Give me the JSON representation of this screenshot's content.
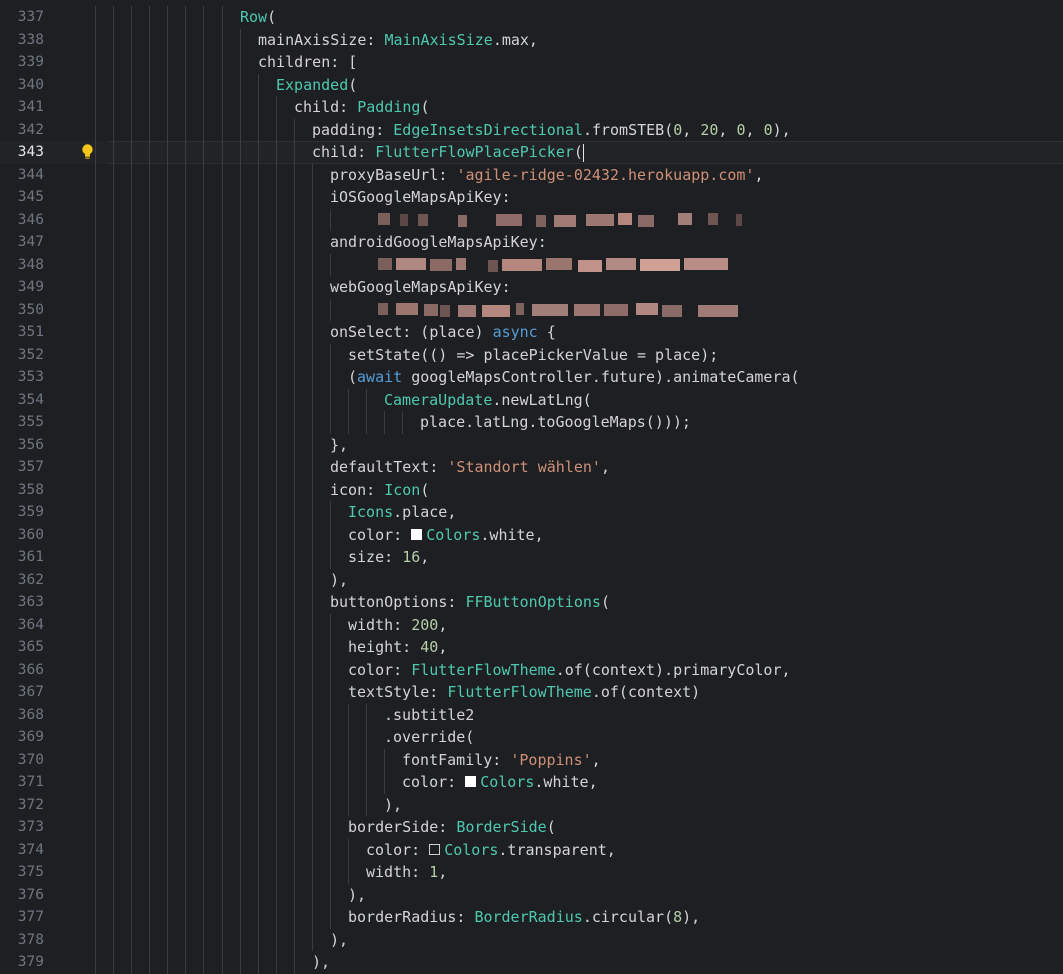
{
  "editor": {
    "colors": {
      "background": "#1e1f22",
      "text": "#d4d4d4",
      "type": "#4ec9b0",
      "string": "#ce9178",
      "number": "#b5cea8",
      "keyword": "#569cd6",
      "lineNumber": "#6e7681",
      "guide": "#3a3c40",
      "bulb": "#f5c518"
    },
    "activeLine": 343,
    "lines": [
      {
        "n": "337",
        "indent": 8,
        "tokens": [
          {
            "t": "Row",
            "c": "type"
          },
          {
            "t": "("
          }
        ]
      },
      {
        "n": "338",
        "indent": 9,
        "tokens": [
          {
            "t": "mainAxisSize: "
          },
          {
            "t": "MainAxisSize",
            "c": "type"
          },
          {
            "t": ".max,"
          }
        ]
      },
      {
        "n": "339",
        "indent": 9,
        "tokens": [
          {
            "t": "children: ["
          }
        ]
      },
      {
        "n": "340",
        "indent": 10,
        "tokens": [
          {
            "t": "Expanded",
            "c": "type"
          },
          {
            "t": "("
          }
        ]
      },
      {
        "n": "341",
        "indent": 11,
        "tokens": [
          {
            "t": "child: "
          },
          {
            "t": "Padding",
            "c": "type"
          },
          {
            "t": "("
          }
        ]
      },
      {
        "n": "342",
        "indent": 12,
        "tokens": [
          {
            "t": "padding: "
          },
          {
            "t": "EdgeInsetsDirectional",
            "c": "type"
          },
          {
            "t": ".fromSTEB("
          },
          {
            "t": "0",
            "c": "number"
          },
          {
            "t": ", "
          },
          {
            "t": "20",
            "c": "number"
          },
          {
            "t": ", "
          },
          {
            "t": "0",
            "c": "number"
          },
          {
            "t": ", "
          },
          {
            "t": "0",
            "c": "number"
          },
          {
            "t": "),"
          }
        ]
      },
      {
        "n": "343",
        "indent": 12,
        "bulb": true,
        "cursor": true,
        "tokens": [
          {
            "t": "child: "
          },
          {
            "t": "FlutterFlowPlacePicker",
            "c": "type"
          },
          {
            "t": "("
          }
        ]
      },
      {
        "n": "344",
        "indent": 13,
        "tokens": [
          {
            "t": "proxyBaseUrl: "
          },
          {
            "t": "'agile-ridge-02432.herokuapp.com'",
            "c": "string"
          },
          {
            "t": ","
          }
        ]
      },
      {
        "n": "345",
        "indent": 13,
        "tokens": [
          {
            "t": "iOSGoogleMapsApiKey:"
          }
        ]
      },
      {
        "n": "346",
        "indent": 14,
        "redact": "a",
        "tokens": []
      },
      {
        "n": "347",
        "indent": 13,
        "tokens": [
          {
            "t": "androidGoogleMapsApiKey:"
          }
        ]
      },
      {
        "n": "348",
        "indent": 14,
        "redact": "b",
        "tokens": []
      },
      {
        "n": "349",
        "indent": 13,
        "tokens": [
          {
            "t": "webGoogleMapsApiKey:"
          }
        ]
      },
      {
        "n": "350",
        "indent": 14,
        "redact": "c",
        "tokens": []
      },
      {
        "n": "351",
        "indent": 13,
        "tokens": [
          {
            "t": "onSelect: (place) "
          },
          {
            "t": "async",
            "c": "keyword"
          },
          {
            "t": " {"
          }
        ]
      },
      {
        "n": "352",
        "indent": 14,
        "tokens": [
          {
            "t": "setState(() => placePickerValue = place);"
          }
        ]
      },
      {
        "n": "353",
        "indent": 14,
        "tokens": [
          {
            "t": "("
          },
          {
            "t": "await",
            "c": "keyword"
          },
          {
            "t": " googleMapsController.future).animateCamera("
          }
        ]
      },
      {
        "n": "354",
        "indent": 16,
        "tokens": [
          {
            "t": "CameraUpdate",
            "c": "type"
          },
          {
            "t": ".newLatLng("
          }
        ]
      },
      {
        "n": "355",
        "indent": 18,
        "tokens": [
          {
            "t": "place.latLng.toGoogleMaps()));"
          }
        ]
      },
      {
        "n": "356",
        "indent": 13,
        "tokens": [
          {
            "t": "},"
          }
        ]
      },
      {
        "n": "357",
        "indent": 13,
        "tokens": [
          {
            "t": "defaultText: "
          },
          {
            "t": "'Standort wählen'",
            "c": "string"
          },
          {
            "t": ","
          }
        ]
      },
      {
        "n": "358",
        "indent": 13,
        "tokens": [
          {
            "t": "icon: "
          },
          {
            "t": "Icon",
            "c": "type"
          },
          {
            "t": "("
          }
        ]
      },
      {
        "n": "359",
        "indent": 14,
        "tokens": [
          {
            "t": "Icons",
            "c": "type"
          },
          {
            "t": ".place,"
          }
        ]
      },
      {
        "n": "360",
        "indent": 14,
        "tokens": [
          {
            "t": "color: "
          },
          {
            "sw": "white"
          },
          {
            "t": "Colors",
            "c": "type"
          },
          {
            "t": ".white,"
          }
        ]
      },
      {
        "n": "361",
        "indent": 14,
        "tokens": [
          {
            "t": "size: "
          },
          {
            "t": "16",
            "c": "number"
          },
          {
            "t": ","
          }
        ]
      },
      {
        "n": "362",
        "indent": 13,
        "tokens": [
          {
            "t": "),"
          }
        ]
      },
      {
        "n": "363",
        "indent": 13,
        "tokens": [
          {
            "t": "buttonOptions: "
          },
          {
            "t": "FFButtonOptions",
            "c": "type"
          },
          {
            "t": "("
          }
        ]
      },
      {
        "n": "364",
        "indent": 14,
        "tokens": [
          {
            "t": "width: "
          },
          {
            "t": "200",
            "c": "number"
          },
          {
            "t": ","
          }
        ]
      },
      {
        "n": "365",
        "indent": 14,
        "tokens": [
          {
            "t": "height: "
          },
          {
            "t": "40",
            "c": "number"
          },
          {
            "t": ","
          }
        ]
      },
      {
        "n": "366",
        "indent": 14,
        "tokens": [
          {
            "t": "color: "
          },
          {
            "t": "FlutterFlowTheme",
            "c": "type"
          },
          {
            "t": ".of(context).primaryColor,"
          }
        ]
      },
      {
        "n": "367",
        "indent": 14,
        "tokens": [
          {
            "t": "textStyle: "
          },
          {
            "t": "FlutterFlowTheme",
            "c": "type"
          },
          {
            "t": ".of(context)"
          }
        ]
      },
      {
        "n": "368",
        "indent": 16,
        "tokens": [
          {
            "t": ".subtitle2"
          }
        ]
      },
      {
        "n": "369",
        "indent": 16,
        "tokens": [
          {
            "t": ".override("
          }
        ]
      },
      {
        "n": "370",
        "indent": 17,
        "tokens": [
          {
            "t": "fontFamily: "
          },
          {
            "t": "'Poppins'",
            "c": "string"
          },
          {
            "t": ","
          }
        ]
      },
      {
        "n": "371",
        "indent": 17,
        "tokens": [
          {
            "t": "color: "
          },
          {
            "sw": "white"
          },
          {
            "t": "Colors",
            "c": "type"
          },
          {
            "t": ".white,"
          }
        ]
      },
      {
        "n": "372",
        "indent": 16,
        "tokens": [
          {
            "t": "),"
          }
        ]
      },
      {
        "n": "373",
        "indent": 14,
        "tokens": [
          {
            "t": "borderSide: "
          },
          {
            "t": "BorderSide",
            "c": "type"
          },
          {
            "t": "("
          }
        ]
      },
      {
        "n": "374",
        "indent": 15,
        "tokens": [
          {
            "t": "color: "
          },
          {
            "sw": "transparent"
          },
          {
            "t": "Colors",
            "c": "type"
          },
          {
            "t": ".transparent,"
          }
        ]
      },
      {
        "n": "375",
        "indent": 15,
        "tokens": [
          {
            "t": "width: "
          },
          {
            "t": "1",
            "c": "number"
          },
          {
            "t": ","
          }
        ]
      },
      {
        "n": "376",
        "indent": 14,
        "tokens": [
          {
            "t": "),"
          }
        ]
      },
      {
        "n": "377",
        "indent": 14,
        "tokens": [
          {
            "t": "borderRadius: "
          },
          {
            "t": "BorderRadius",
            "c": "type"
          },
          {
            "t": ".circular("
          },
          {
            "t": "8",
            "c": "number"
          },
          {
            "t": "),"
          }
        ]
      },
      {
        "n": "378",
        "indent": 13,
        "tokens": [
          {
            "t": "),"
          }
        ]
      },
      {
        "n": "379",
        "indent": 12,
        "tokens": [
          {
            "t": "),"
          }
        ]
      }
    ]
  }
}
